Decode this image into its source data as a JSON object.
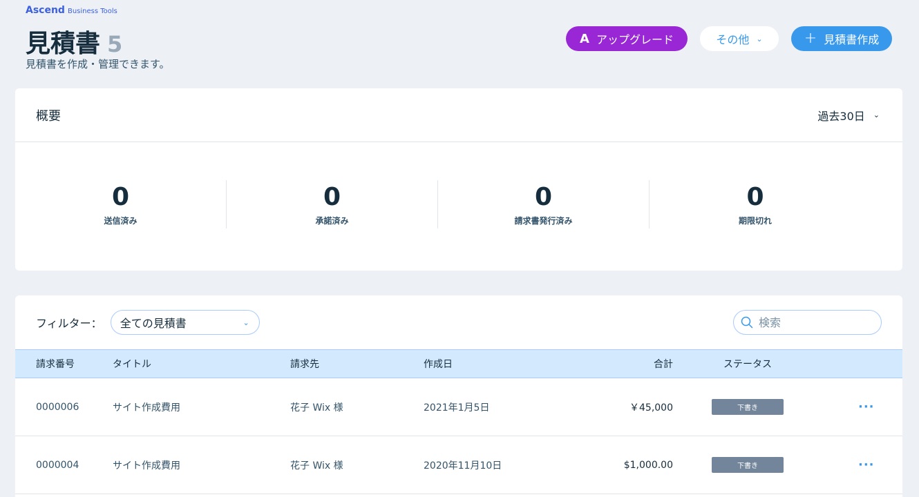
{
  "brand": {
    "name": "Ascend",
    "sub": "Business Tools"
  },
  "header": {
    "title": "見積書",
    "count": "5",
    "subtitle": "見積書を作成・管理できます。",
    "upgrade_label": "アップグレード",
    "more_label": "その他",
    "create_label": "見積書作成"
  },
  "overview": {
    "title": "概要",
    "period": "過去30日",
    "stats": [
      {
        "value": "0",
        "label": "送信済み"
      },
      {
        "value": "0",
        "label": "承諾済み"
      },
      {
        "value": "0",
        "label": "請求書発行済み"
      },
      {
        "value": "0",
        "label": "期限切れ"
      }
    ]
  },
  "list": {
    "filter_label": "フィルター：",
    "filter_value": "全ての見積書",
    "search_placeholder": "検索",
    "columns": {
      "number": "請求番号",
      "title": "タイトル",
      "client": "請求先",
      "date": "作成日",
      "total": "合計",
      "status": "ステータス"
    },
    "rows": [
      {
        "number": "0000006",
        "title": "サイト作成費用",
        "client": "花子 Wix 様",
        "date": "2021年1月5日",
        "total": "￥45,000",
        "status": "下書き"
      },
      {
        "number": "0000004",
        "title": "サイト作成費用",
        "client": "花子 Wix 様",
        "date": "2020年11月10日",
        "total": "$1,000.00",
        "status": "下書き"
      }
    ]
  },
  "colors": {
    "accent": "#3899ec",
    "upgrade": "#9a27d5",
    "badge": "#72859a",
    "background": "#edf1f6"
  },
  "icons": [
    "ascend-a-icon",
    "chevron-down-icon",
    "plus-icon",
    "search-icon",
    "more-dots-icon"
  ]
}
